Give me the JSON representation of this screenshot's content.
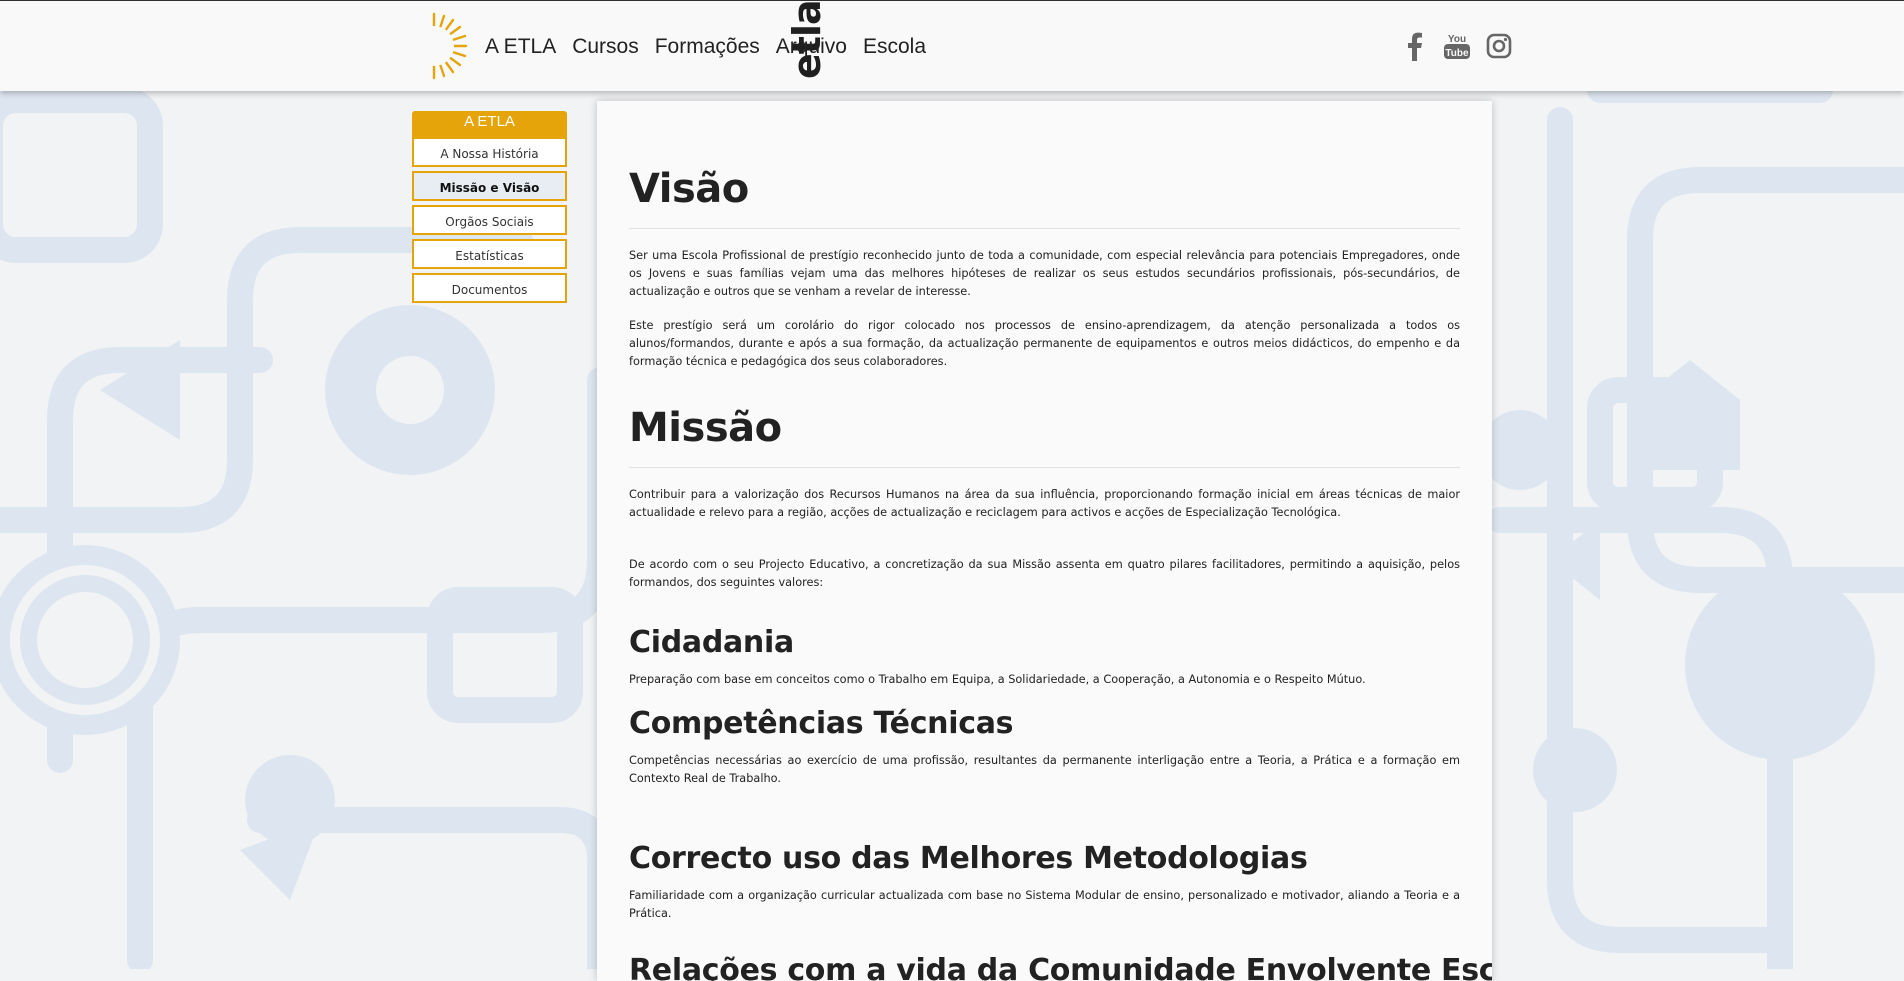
{
  "header": {
    "logo_text": "etla",
    "nav": [
      "A ETLA",
      "Cursos",
      "Formações",
      "Arquivo",
      "Escola"
    ],
    "social_icons": [
      "facebook-icon",
      "youtube-icon",
      "instagram-icon"
    ],
    "accent_color": "#e5a50a"
  },
  "sidebar": {
    "title": "A ETLA",
    "items": [
      {
        "label": "A Nossa História"
      },
      {
        "label": "Missão e Visão",
        "active": true
      },
      {
        "label": "Orgãos Sociais"
      },
      {
        "label": "Estatísticas"
      },
      {
        "label": "Documentos"
      }
    ]
  },
  "content": {
    "visao": {
      "heading": "Visão",
      "p1": "Ser uma Escola Profissional de prestígio reconhecido junto de toda a comunidade, com especial relevância para potenciais Empregadores, onde os Jovens e suas famílias vejam uma das melhores hipóteses de realizar os seus estudos secundários profissionais, pós-secundários, de actualização e outros que se venham a revelar de interesse.",
      "p2": "Este prestígio será um corolário do rigor colocado nos processos de ensino-aprendizagem, da atenção personalizada a todos os alunos/formandos, durante e após a sua formação, da actualização permanente de equipamentos e outros meios didácticos, do empenho e da formação técnica e pedagógica dos seus colaboradores."
    },
    "missao": {
      "heading": "Missão",
      "p1": "Contribuir para a valorização dos Recursos Humanos na área da sua influência, proporcionando formação inicial em áreas técnicas de maior actualidade e relevo para a região, acções de actualização e reciclagem para activos e acções de Especialização Tecnológica.",
      "p2": "De acordo com o seu Projecto Educativo, a concretização da sua Missão assenta em quatro pilares facilitadores, permitindo a aquisição, pelos formandos, dos seguintes valores:"
    },
    "pillars": [
      {
        "title": "Cidadania",
        "text": "Preparação com base em conceitos como o Trabalho em Equipa, a Solidariedade, a Cooperação, a Autonomia e o Respeito Mútuo."
      },
      {
        "title": "Competências Técnicas",
        "text": "Competências necessárias ao exercício de uma profissão, resultantes da permanente interligação entre a Teoria, a Prática e a formação em Contexto Real de Trabalho."
      },
      {
        "title": "Correcto uso das Melhores Metodologias",
        "text": "Familiaridade com a organização curricular actualizada com base no Sistema Modular de ensino, personalizado e motivador, aliando a Teoria e a Prática."
      },
      {
        "title": "Relações com a vida da Comunidade Envolvente Escola-Empresa"
      }
    ]
  }
}
